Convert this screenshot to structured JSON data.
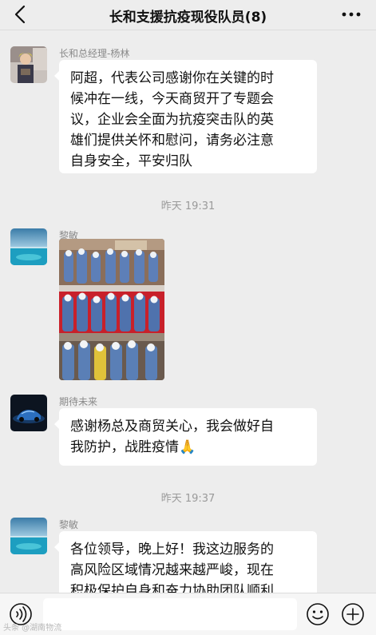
{
  "header": {
    "title": "长和支援抗疫现役队员(8)",
    "back_icon": "chevron-left-icon",
    "more_icon": "ellipsis-icon"
  },
  "messages": [
    {
      "sender": "长和总经理-杨林",
      "lines": [
        "阿超，代表公司感谢你在关键的时",
        "候冲在一线，今天商贸开了专题会",
        "议，企业会全面为抗疫突击队的英",
        "雄们提供关怀和慰问，请务必注意",
        "自身安全，平安归队"
      ]
    },
    {
      "timestamp": "昨天 19:31"
    },
    {
      "sender": "黎敏",
      "type": "image"
    },
    {
      "sender": "期待未来",
      "lines": [
        "感谢杨总及商贸关心，我会做好自",
        "我防护，战胜疫情"
      ],
      "emoji": "🙏"
    },
    {
      "timestamp": "昨天 19:37"
    },
    {
      "sender": "黎敏",
      "lines": [
        "各位领导，晚上好！我这边服务的",
        "高风险区域情况越来越严峻，现在",
        "积极保护自身和奋力协助团队顺利"
      ]
    }
  ],
  "input_bar": {
    "placeholder": "",
    "voice_icon": "voice-icon",
    "emoji_icon": "smiley-icon",
    "plus_icon": "plus-icon"
  },
  "watermark": "头条 @湖南物流"
}
